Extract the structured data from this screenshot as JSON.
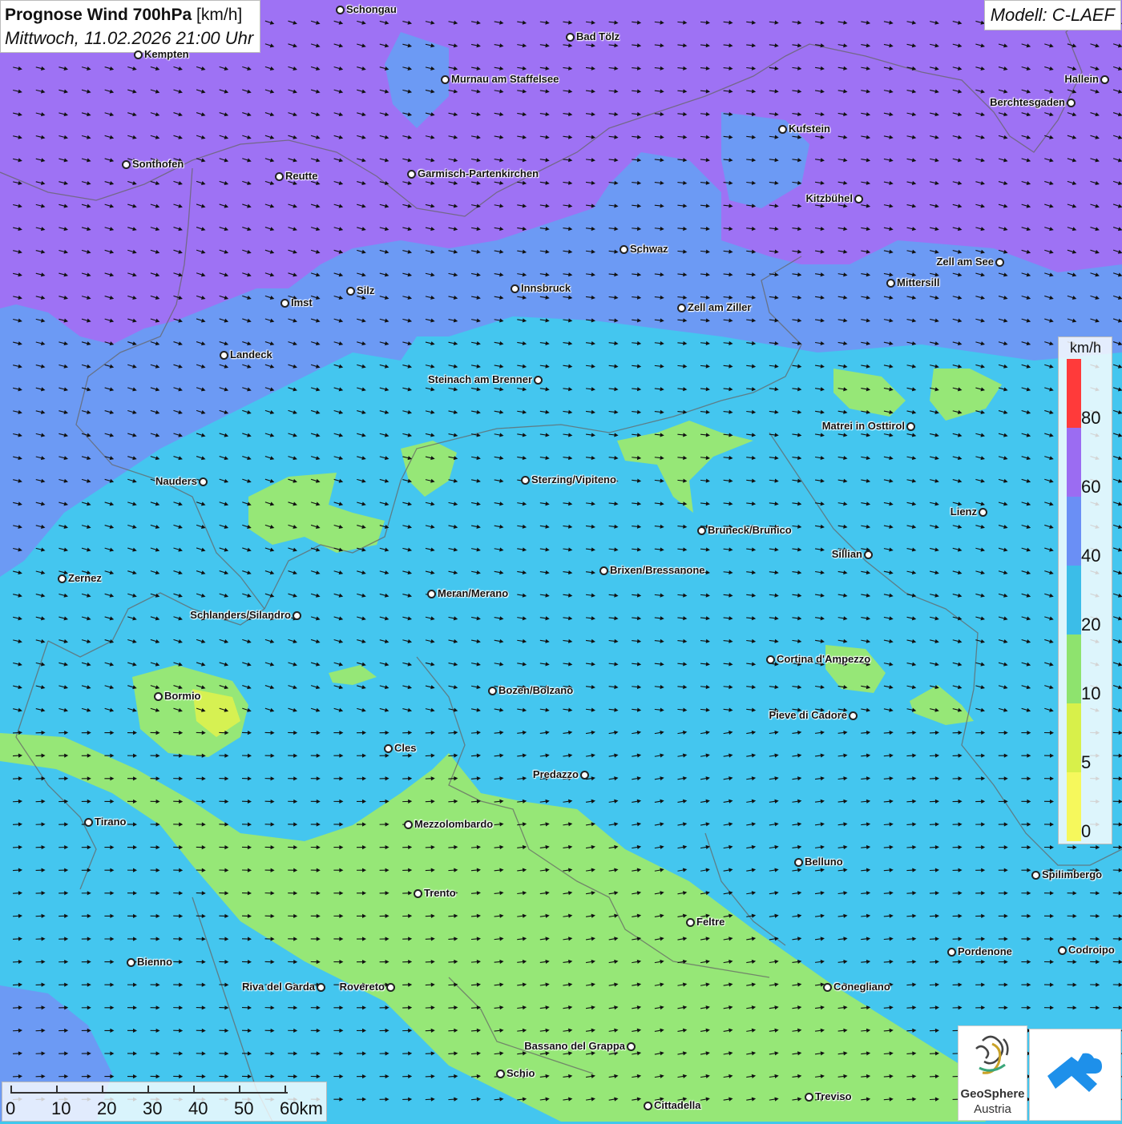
{
  "header": {
    "title": "Prognose Wind 700hPa",
    "unit": "[km/h]",
    "datetime": "Mittwoch, 11.02.2026 21:00 Uhr",
    "model": "Modell: C-LAEF"
  },
  "legend": {
    "unit": "km/h",
    "ticks": [
      "80",
      "60",
      "40",
      "20",
      "10",
      "5",
      "0"
    ],
    "colors": [
      "#ff3a3a",
      "#9b6cf2",
      "#6a8ff5",
      "#3bbde8",
      "#8ee36e",
      "#d8f04a",
      "#f6f85c"
    ]
  },
  "scale": {
    "labels": [
      "0",
      "10",
      "20",
      "30",
      "40",
      "50",
      "60km"
    ]
  },
  "logos": {
    "geosphere_name": "GeoSphere",
    "geosphere_sub": "Austria"
  },
  "map": {
    "colors": {
      "strong": "#9e72f4",
      "medium": "#6c9af4",
      "moderate": "#44c6ef",
      "weak": "#96e777",
      "calm": "#d6f152"
    },
    "cities": [
      {
        "name": "Schongau",
        "label_pos": "right"
      },
      {
        "name": "Bad Tölz",
        "label_pos": "right"
      },
      {
        "name": "Kempten",
        "label_pos": "right"
      },
      {
        "name": "Murnau am Staffelsee",
        "label_pos": "right"
      },
      {
        "name": "Hallein",
        "label_pos": "left"
      },
      {
        "name": "Berchtesgaden",
        "label_pos": "left"
      },
      {
        "name": "Kufstein",
        "label_pos": "right"
      },
      {
        "name": "Sonthofen",
        "label_pos": "right"
      },
      {
        "name": "Reutte",
        "label_pos": "right"
      },
      {
        "name": "Garmisch-Partenkirchen",
        "label_pos": "right"
      },
      {
        "name": "Kitzbühel",
        "label_pos": "left"
      },
      {
        "name": "Schwaz",
        "label_pos": "right"
      },
      {
        "name": "Zell am See",
        "label_pos": "left"
      },
      {
        "name": "Mittersill",
        "label_pos": "right"
      },
      {
        "name": "Innsbruck",
        "label_pos": "right"
      },
      {
        "name": "Silz",
        "label_pos": "right"
      },
      {
        "name": "Imst",
        "label_pos": "right"
      },
      {
        "name": "Zell am Ziller",
        "label_pos": "right"
      },
      {
        "name": "Landeck",
        "label_pos": "right"
      },
      {
        "name": "Steinach am Brenner",
        "label_pos": "left"
      },
      {
        "name": "Matrei in Osttirol",
        "label_pos": "left"
      },
      {
        "name": "Nauders",
        "label_pos": "left"
      },
      {
        "name": "Sterzing/Vipiteno",
        "label_pos": "right"
      },
      {
        "name": "Lienz",
        "label_pos": "left"
      },
      {
        "name": "Bruneck/Brunico",
        "label_pos": "right"
      },
      {
        "name": "Sillian",
        "label_pos": "left"
      },
      {
        "name": "Zernez",
        "label_pos": "right"
      },
      {
        "name": "Brixen/Bressanone",
        "label_pos": "right"
      },
      {
        "name": "Meran/Merano",
        "label_pos": "right"
      },
      {
        "name": "Schlanders/Silandro",
        "label_pos": "left"
      },
      {
        "name": "Cortina d'Ampezzo",
        "label_pos": "right"
      },
      {
        "name": "Bormio",
        "label_pos": "right"
      },
      {
        "name": "Bozen/Bolzano",
        "label_pos": "right"
      },
      {
        "name": "Pieve di Cadore",
        "label_pos": "left"
      },
      {
        "name": "Cles",
        "label_pos": "right"
      },
      {
        "name": "Predazzo",
        "label_pos": "left"
      },
      {
        "name": "Tirano",
        "label_pos": "right"
      },
      {
        "name": "Mezzolombardo",
        "label_pos": "right"
      },
      {
        "name": "Belluno",
        "label_pos": "right"
      },
      {
        "name": "Spilimbergo",
        "label_pos": "right"
      },
      {
        "name": "Trento",
        "label_pos": "right"
      },
      {
        "name": "Feltre",
        "label_pos": "right"
      },
      {
        "name": "Pordenone",
        "label_pos": "right"
      },
      {
        "name": "Codroipo",
        "label_pos": "right"
      },
      {
        "name": "Bienno",
        "label_pos": "right"
      },
      {
        "name": "Riva del Garda",
        "label_pos": "left"
      },
      {
        "name": "Rovereto",
        "label_pos": "left"
      },
      {
        "name": "Conegliano",
        "label_pos": "right"
      },
      {
        "name": "Bassano del Grappa",
        "label_pos": "left"
      },
      {
        "name": "Schio",
        "label_pos": "right"
      },
      {
        "name": "Treviso",
        "label_pos": "right"
      },
      {
        "name": "Cittadella",
        "label_pos": "right"
      }
    ]
  }
}
